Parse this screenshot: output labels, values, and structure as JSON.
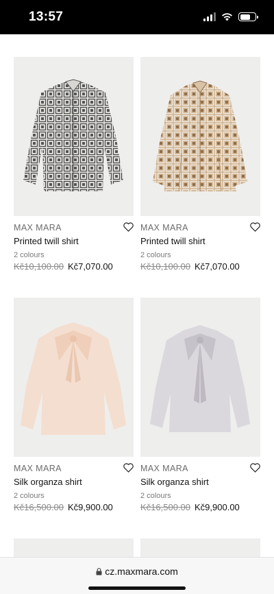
{
  "status_bar": {
    "time": "13:57"
  },
  "products": [
    {
      "brand": "MAX MARA",
      "title": "Printed twill shirt",
      "colours": "2 colours",
      "old_price": "Kč10,100.00",
      "new_price": "Kč7,070.00",
      "image": "printed-shirt-grey"
    },
    {
      "brand": "MAX MARA",
      "title": "Printed twill shirt",
      "colours": "2 colours",
      "old_price": "Kč10,100.00",
      "new_price": "Kč7,070.00",
      "image": "printed-shirt-beige"
    },
    {
      "brand": "MAX MARA",
      "title": "Silk organza shirt",
      "colours": "2 colours",
      "old_price": "Kč16,500.00",
      "new_price": "Kč9,900.00",
      "image": "organza-shirt-pink"
    },
    {
      "brand": "MAX MARA",
      "title": "Silk organza shirt",
      "colours": "2 colours",
      "old_price": "Kč16,500.00",
      "new_price": "Kč9,900.00",
      "image": "organza-shirt-grey"
    }
  ],
  "browser": {
    "url": "cz.maxmara.com"
  }
}
